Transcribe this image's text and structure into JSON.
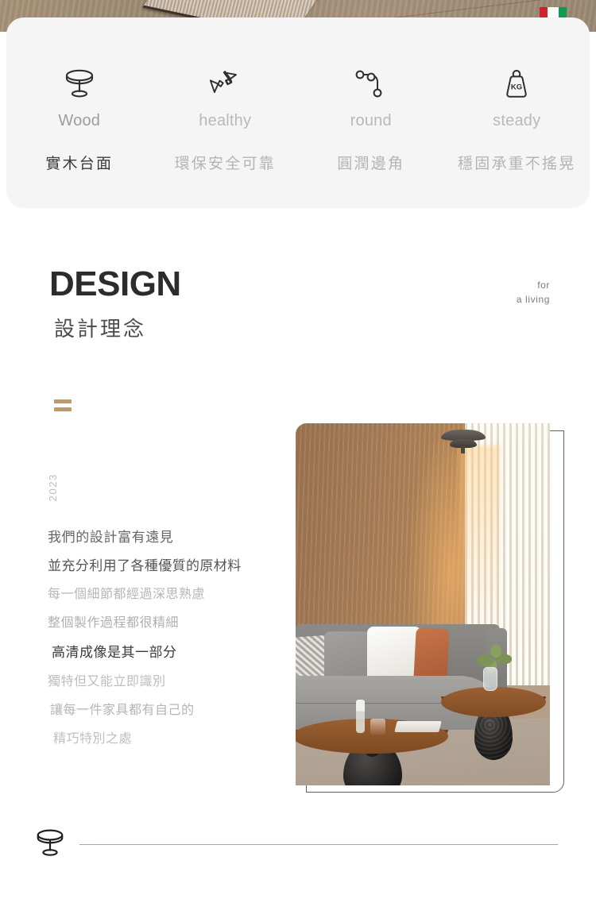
{
  "hero": {
    "flag_icon": "italy-flag-icon",
    "flag_colors": {
      "green": "#0f9b52",
      "white": "#ffffff",
      "red": "#d3202a"
    }
  },
  "features": [
    {
      "icon": "round-table-icon",
      "en": "Wood",
      "cn": "實木台面",
      "primary": true
    },
    {
      "icon": "recycle-icon",
      "en": "healthy",
      "cn": "環保安全可靠",
      "primary": false
    },
    {
      "icon": "rounded-corner-icon",
      "en": "round",
      "cn": "圓潤邊角",
      "primary": false
    },
    {
      "icon": "weight-kg-icon",
      "en": "steady",
      "cn": "穩固承重不搖晃",
      "primary": false
    }
  ],
  "design": {
    "title": "DESIGN",
    "subtitle": "設計理念",
    "tag_line1": "for",
    "tag_line2": "a living",
    "year": "2023",
    "accent_color": "#c29a68"
  },
  "copy": {
    "lines": [
      "我們的設計富有遠見",
      "並充分利用了各種優質的原材料",
      "每一個細節都經過深思熟慮",
      "整個製作過程都很精細",
      "高清成像是其一部分",
      "獨特但又能立即識別",
      "讓每一件家具都有自己的",
      "精巧特別之處"
    ]
  },
  "photo": {
    "alt": "living-room-with-round-wooden-coffee-tables"
  },
  "footer": {
    "icon": "round-table-icon",
    "rule_color": "#c0a070"
  }
}
